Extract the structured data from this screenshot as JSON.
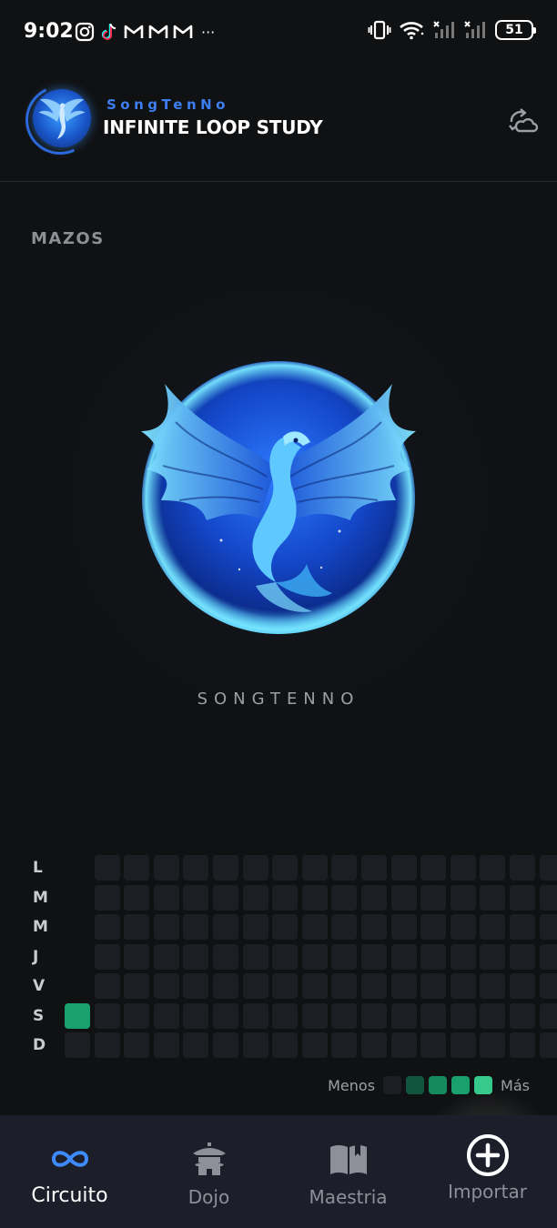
{
  "status_bar": {
    "time": "9:02",
    "notification_icons": [
      "instagram-icon",
      "tiktok-icon",
      "gmail-icon",
      "gmail-icon",
      "gmail-icon"
    ],
    "overflow": "···",
    "battery": "51"
  },
  "header": {
    "brand": "SongTenNo",
    "title": "INFINITE LOOP STUDY",
    "action_icon": "sync-cloud-icon"
  },
  "section": {
    "label": "MAZOS"
  },
  "deck": {
    "name": "SONGTENNO"
  },
  "heatmap": {
    "day_labels": [
      "L",
      "M",
      "M",
      "J",
      "V",
      "S",
      "D"
    ],
    "active": [
      {
        "day": 5,
        "week": 0,
        "level": 4
      }
    ],
    "legend": {
      "less": "Menos",
      "more": "Más",
      "levels": [
        "#1b1e23",
        "#11553f",
        "#158a5c",
        "#19a06c",
        "#35c98c"
      ]
    }
  },
  "nav": {
    "items": [
      {
        "label": "Circuito",
        "icon": "infinity-icon",
        "active": true
      },
      {
        "label": "Dojo",
        "icon": "dojo-icon",
        "active": false
      },
      {
        "label": "Maestria",
        "icon": "book-icon",
        "active": false
      },
      {
        "label": "Importar",
        "icon": "plus-circle-icon",
        "active": false
      }
    ]
  },
  "colors": {
    "accent": "#3d7ff2",
    "heat_active": "#19a06c",
    "background": "#101112",
    "nav_bg": "#1c1e2a"
  }
}
